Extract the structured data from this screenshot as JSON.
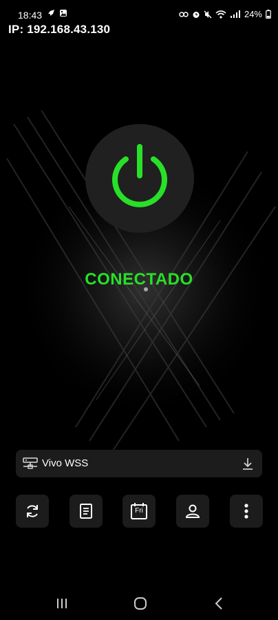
{
  "status_bar": {
    "time": "18:43",
    "battery": "24%"
  },
  "connection": {
    "ip_label": "IP: 192.168.43.130",
    "status": "CONECTADO",
    "status_color": "#28e028"
  },
  "server": {
    "name": "Vivo WSS"
  },
  "actions": {
    "calendar_day": "Fri"
  },
  "icons": {
    "status_left": [
      "rocket-icon",
      "image-icon"
    ],
    "status_right": [
      "link-icon",
      "alarm-icon",
      "mute-icon",
      "wifi-icon",
      "signal-icon",
      "battery-icon"
    ],
    "main": "power-icon",
    "server": "server-icon",
    "server_action": "download-icon",
    "action_buttons": [
      "refresh-icon",
      "document-icon",
      "calendar-icon",
      "user-icon",
      "more-icon"
    ],
    "nav": [
      "recents-icon",
      "home-icon",
      "back-icon"
    ]
  },
  "colors": {
    "background": "#000000",
    "accent": "#28e028",
    "panel": "#1c1c1c"
  }
}
